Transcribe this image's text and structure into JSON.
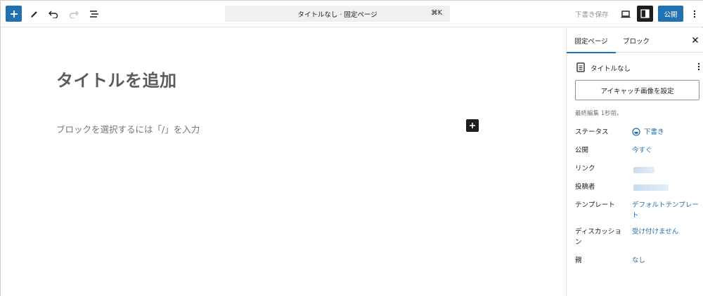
{
  "toolbar": {
    "command_title": "タイトルなし · 固定ページ",
    "command_shortcut": "⌘K",
    "save_draft_label": "下書き保存",
    "publish_label": "公開"
  },
  "editor": {
    "title_placeholder": "タイトルを追加",
    "block_placeholder": "ブロックを選択するには「/」を入力"
  },
  "sidebar": {
    "tabs": [
      {
        "label": "固定ページ"
      },
      {
        "label": "ブロック"
      }
    ],
    "document_title": "タイトルなし",
    "featured_image_label": "アイキャッチ画像を設定",
    "last_edited": "最終編集 1秒前。",
    "properties": [
      {
        "label": "ステータス",
        "value": "下書き"
      },
      {
        "label": "公開",
        "value": "今すぐ"
      },
      {
        "label": "リンク",
        "value": ""
      },
      {
        "label": "投稿者",
        "value": ""
      },
      {
        "label": "テンプレート",
        "value": "デフォルトテンプレート"
      },
      {
        "label": "ディスカッション",
        "value": "受け付けません"
      },
      {
        "label": "親",
        "value": "なし"
      }
    ]
  },
  "colors": {
    "accent": "#2271b1",
    "dark": "#1e1e1e",
    "muted": "#757575"
  }
}
